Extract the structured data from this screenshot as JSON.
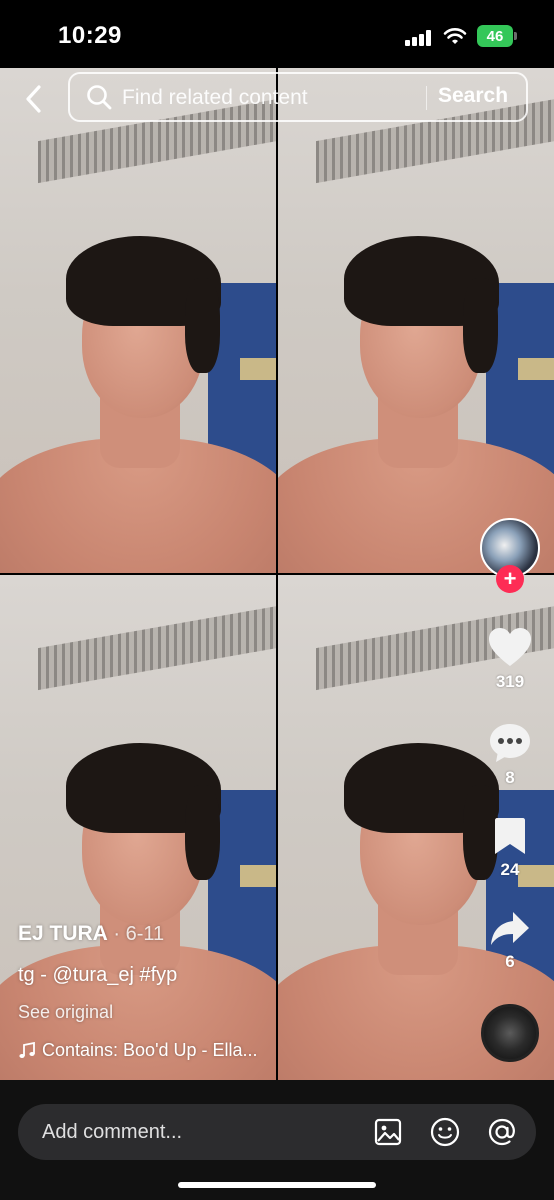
{
  "status_bar": {
    "time": "10:29",
    "battery": "46"
  },
  "search": {
    "placeholder": "Find related content",
    "button_label": "Search"
  },
  "sidebar": {
    "likes": "319",
    "comments": "8",
    "saves": "24",
    "shares": "6",
    "follow_symbol": "+"
  },
  "caption": {
    "author": "EJ TURA",
    "date": " · 6-11",
    "description": "tg - @tura_ej #fyp",
    "see_original": "See original",
    "music": "Contains: Boo'd Up - Ella..."
  },
  "comment_bar": {
    "placeholder": "Add comment..."
  },
  "icons": [
    "back-icon",
    "search-icon",
    "heart-icon",
    "comment-icon",
    "bookmark-icon",
    "share-icon",
    "music-note-icon",
    "image-icon",
    "emoji-icon",
    "mention-icon"
  ],
  "colors": {
    "follow": "#fe2c55",
    "battery": "#34c759",
    "wall": "#2d4c8c"
  }
}
